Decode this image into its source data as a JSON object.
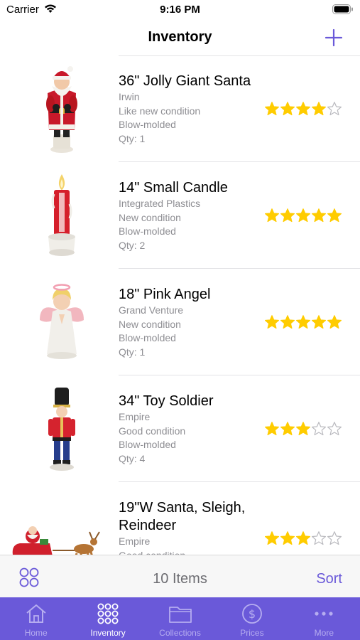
{
  "status_bar": {
    "carrier": "Carrier",
    "time": "9:16 PM"
  },
  "nav": {
    "title": "Inventory"
  },
  "items": [
    {
      "title": "36\" Jolly Giant Santa",
      "maker": "Irwin",
      "condition": "Like new condition",
      "type": "Blow-molded",
      "qty": "Qty: 1",
      "rating": 4
    },
    {
      "title": "14\" Small Candle",
      "maker": "Integrated Plastics",
      "condition": "New condition",
      "type": "Blow-molded",
      "qty": "Qty: 2",
      "rating": 5
    },
    {
      "title": "18\" Pink Angel",
      "maker": "Grand Venture",
      "condition": "New condition",
      "type": "Blow-molded",
      "qty": "Qty: 1",
      "rating": 5
    },
    {
      "title": "34\" Toy Soldier",
      "maker": "Empire",
      "condition": "Good condition",
      "type": "Blow-molded",
      "qty": "Qty: 4",
      "rating": 3
    },
    {
      "title": "19\"W Santa, Sleigh, Reindeer",
      "maker": "Empire",
      "condition": "Good condition",
      "type": "",
      "qty": "",
      "rating": 3
    }
  ],
  "toolbar": {
    "count": "10 Items",
    "sort_label": "Sort"
  },
  "tabs": [
    {
      "label": "Home",
      "icon": "home-icon",
      "active": false
    },
    {
      "label": "Inventory",
      "icon": "inventory-grid-icon",
      "active": true
    },
    {
      "label": "Collections",
      "icon": "folder-icon",
      "active": false
    },
    {
      "label": "Prices",
      "icon": "dollar-circle-icon",
      "active": false
    },
    {
      "label": "More",
      "icon": "more-dots-icon",
      "active": false
    }
  ],
  "colors": {
    "accent": "#6a59d9",
    "star": "#ffcc00",
    "secondary_text": "#8e8e93"
  }
}
